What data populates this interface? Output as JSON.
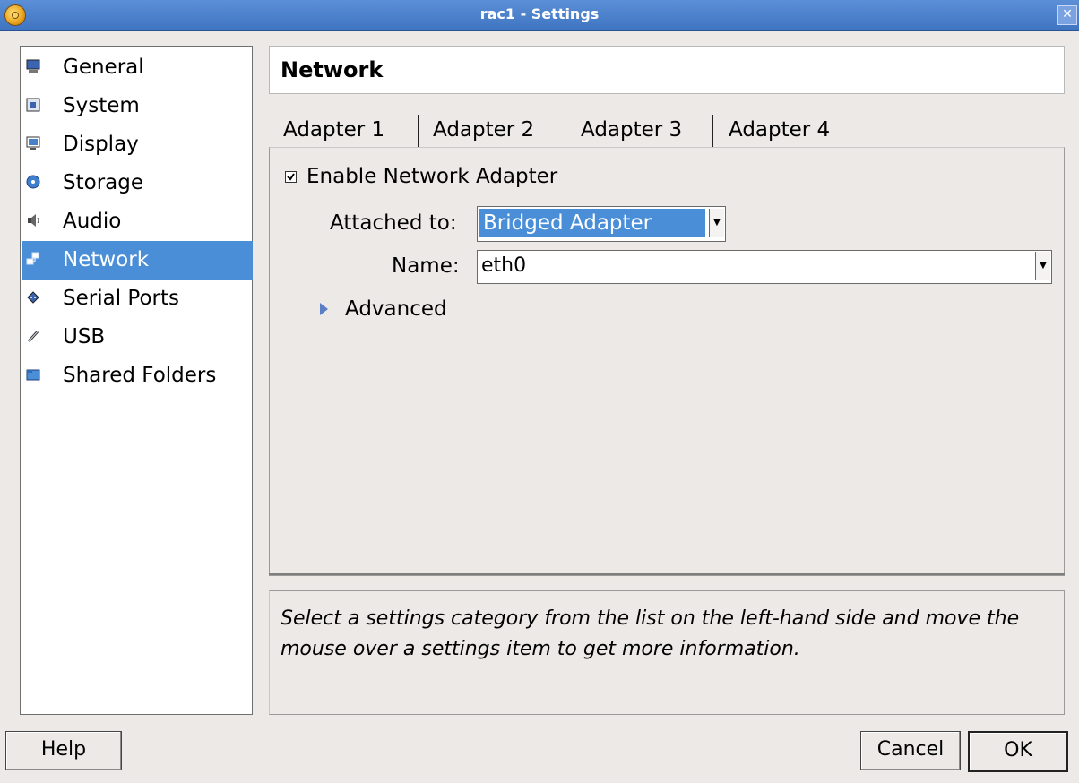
{
  "window": {
    "title": "rac1 - Settings"
  },
  "sidebar": {
    "items": [
      {
        "label": "General",
        "icon": "monitor-icon"
      },
      {
        "label": "System",
        "icon": "chip-icon"
      },
      {
        "label": "Display",
        "icon": "display-icon"
      },
      {
        "label": "Storage",
        "icon": "disk-icon"
      },
      {
        "label": "Audio",
        "icon": "speaker-icon"
      },
      {
        "label": "Network",
        "icon": "network-icon",
        "selected": true
      },
      {
        "label": "Serial Ports",
        "icon": "serial-port-icon"
      },
      {
        "label": "USB",
        "icon": "usb-icon"
      },
      {
        "label": "Shared Folders",
        "icon": "folder-icon"
      }
    ]
  },
  "main": {
    "section_title": "Network",
    "tabs": [
      {
        "label": "Adapter 1",
        "active": true
      },
      {
        "label": "Adapter 2"
      },
      {
        "label": "Adapter 3"
      },
      {
        "label": "Adapter 4"
      }
    ],
    "enable_adapter": {
      "label": "Enable Network Adapter",
      "checked": true
    },
    "attached_to": {
      "label": "Attached to:",
      "value": "Bridged Adapter"
    },
    "name": {
      "label": "Name:",
      "value": "eth0"
    },
    "advanced_label": "Advanced"
  },
  "info": {
    "text": "Select a settings category from the list on the left-hand side and move the mouse over a settings item to get more information."
  },
  "buttons": {
    "help": "Help",
    "cancel": "Cancel",
    "ok": "OK"
  },
  "colors": {
    "titlebar": "#4a80cc",
    "selection": "#4a8ed8",
    "background": "#ece9e6"
  }
}
